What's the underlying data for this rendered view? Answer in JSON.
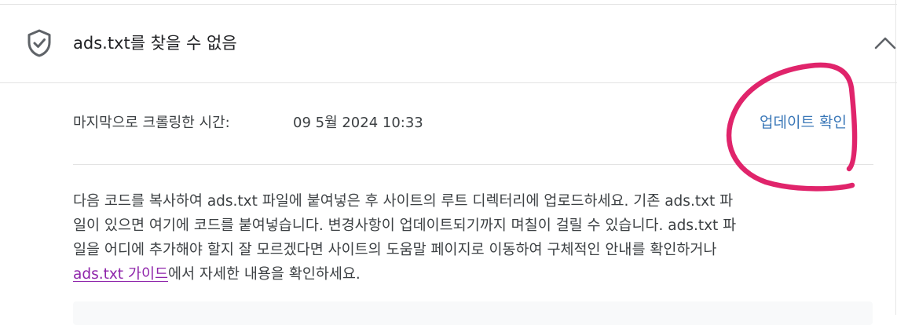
{
  "header": {
    "icon": "shield-check-icon",
    "title": "ads.txt를 찾을 수 없음",
    "toggle_icon": "chevron-up-icon"
  },
  "crawl": {
    "label": "마지막으로 크롤링한 시간:",
    "value": "09 5월 2024 10:33",
    "check_update_label": "업데이트 확인"
  },
  "description": {
    "line1": "다음 코드를 복사하여 ads.txt 파일에 붙여넣은 후 사이트의 루트 디렉터리에 업로드하세요. 기존 ads.txt 파",
    "line2": "일이 있으면 여기에 코드를 붙여넣습니다. 변경사항이 업데이트되기까지 며칠이 걸릴 수 있습니다. ads.txt 파",
    "line3": "일을 어디에 추가해야 할지 잘 모르겠다면 사이트의 도움말 페이지로 이동하여 구체적인 안내를 확인하거나",
    "link_text": "ads.txt 가이드",
    "line4_rest": "에서 자세한 내용을 확인하세요."
  },
  "colors": {
    "link_blue": "#3b78b8",
    "link_visited_purple": "#8e24aa",
    "annotation_pink": "#e0246b"
  }
}
